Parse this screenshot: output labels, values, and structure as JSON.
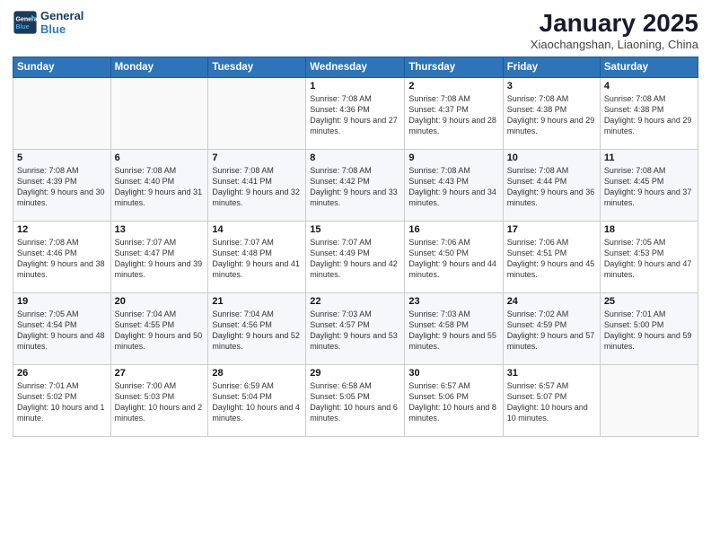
{
  "header": {
    "logo_line1": "General",
    "logo_line2": "Blue",
    "title": "January 2025",
    "subtitle": "Xiaochangshan, Liaoning, China"
  },
  "calendar": {
    "days": [
      "Sunday",
      "Monday",
      "Tuesday",
      "Wednesday",
      "Thursday",
      "Friday",
      "Saturday"
    ],
    "weeks": [
      [
        {
          "date": "",
          "info": ""
        },
        {
          "date": "",
          "info": ""
        },
        {
          "date": "",
          "info": ""
        },
        {
          "date": "1",
          "info": "Sunrise: 7:08 AM\nSunset: 4:36 PM\nDaylight: 9 hours and 27 minutes."
        },
        {
          "date": "2",
          "info": "Sunrise: 7:08 AM\nSunset: 4:37 PM\nDaylight: 9 hours and 28 minutes."
        },
        {
          "date": "3",
          "info": "Sunrise: 7:08 AM\nSunset: 4:38 PM\nDaylight: 9 hours and 29 minutes."
        },
        {
          "date": "4",
          "info": "Sunrise: 7:08 AM\nSunset: 4:38 PM\nDaylight: 9 hours and 29 minutes."
        }
      ],
      [
        {
          "date": "5",
          "info": "Sunrise: 7:08 AM\nSunset: 4:39 PM\nDaylight: 9 hours and 30 minutes."
        },
        {
          "date": "6",
          "info": "Sunrise: 7:08 AM\nSunset: 4:40 PM\nDaylight: 9 hours and 31 minutes."
        },
        {
          "date": "7",
          "info": "Sunrise: 7:08 AM\nSunset: 4:41 PM\nDaylight: 9 hours and 32 minutes."
        },
        {
          "date": "8",
          "info": "Sunrise: 7:08 AM\nSunset: 4:42 PM\nDaylight: 9 hours and 33 minutes."
        },
        {
          "date": "9",
          "info": "Sunrise: 7:08 AM\nSunset: 4:43 PM\nDaylight: 9 hours and 34 minutes."
        },
        {
          "date": "10",
          "info": "Sunrise: 7:08 AM\nSunset: 4:44 PM\nDaylight: 9 hours and 36 minutes."
        },
        {
          "date": "11",
          "info": "Sunrise: 7:08 AM\nSunset: 4:45 PM\nDaylight: 9 hours and 37 minutes."
        }
      ],
      [
        {
          "date": "12",
          "info": "Sunrise: 7:08 AM\nSunset: 4:46 PM\nDaylight: 9 hours and 38 minutes."
        },
        {
          "date": "13",
          "info": "Sunrise: 7:07 AM\nSunset: 4:47 PM\nDaylight: 9 hours and 39 minutes."
        },
        {
          "date": "14",
          "info": "Sunrise: 7:07 AM\nSunset: 4:48 PM\nDaylight: 9 hours and 41 minutes."
        },
        {
          "date": "15",
          "info": "Sunrise: 7:07 AM\nSunset: 4:49 PM\nDaylight: 9 hours and 42 minutes."
        },
        {
          "date": "16",
          "info": "Sunrise: 7:06 AM\nSunset: 4:50 PM\nDaylight: 9 hours and 44 minutes."
        },
        {
          "date": "17",
          "info": "Sunrise: 7:06 AM\nSunset: 4:51 PM\nDaylight: 9 hours and 45 minutes."
        },
        {
          "date": "18",
          "info": "Sunrise: 7:05 AM\nSunset: 4:53 PM\nDaylight: 9 hours and 47 minutes."
        }
      ],
      [
        {
          "date": "19",
          "info": "Sunrise: 7:05 AM\nSunset: 4:54 PM\nDaylight: 9 hours and 48 minutes."
        },
        {
          "date": "20",
          "info": "Sunrise: 7:04 AM\nSunset: 4:55 PM\nDaylight: 9 hours and 50 minutes."
        },
        {
          "date": "21",
          "info": "Sunrise: 7:04 AM\nSunset: 4:56 PM\nDaylight: 9 hours and 52 minutes."
        },
        {
          "date": "22",
          "info": "Sunrise: 7:03 AM\nSunset: 4:57 PM\nDaylight: 9 hours and 53 minutes."
        },
        {
          "date": "23",
          "info": "Sunrise: 7:03 AM\nSunset: 4:58 PM\nDaylight: 9 hours and 55 minutes."
        },
        {
          "date": "24",
          "info": "Sunrise: 7:02 AM\nSunset: 4:59 PM\nDaylight: 9 hours and 57 minutes."
        },
        {
          "date": "25",
          "info": "Sunrise: 7:01 AM\nSunset: 5:00 PM\nDaylight: 9 hours and 59 minutes."
        }
      ],
      [
        {
          "date": "26",
          "info": "Sunrise: 7:01 AM\nSunset: 5:02 PM\nDaylight: 10 hours and 1 minute."
        },
        {
          "date": "27",
          "info": "Sunrise: 7:00 AM\nSunset: 5:03 PM\nDaylight: 10 hours and 2 minutes."
        },
        {
          "date": "28",
          "info": "Sunrise: 6:59 AM\nSunset: 5:04 PM\nDaylight: 10 hours and 4 minutes."
        },
        {
          "date": "29",
          "info": "Sunrise: 6:58 AM\nSunset: 5:05 PM\nDaylight: 10 hours and 6 minutes."
        },
        {
          "date": "30",
          "info": "Sunrise: 6:57 AM\nSunset: 5:06 PM\nDaylight: 10 hours and 8 minutes."
        },
        {
          "date": "31",
          "info": "Sunrise: 6:57 AM\nSunset: 5:07 PM\nDaylight: 10 hours and 10 minutes."
        },
        {
          "date": "",
          "info": ""
        }
      ]
    ]
  }
}
